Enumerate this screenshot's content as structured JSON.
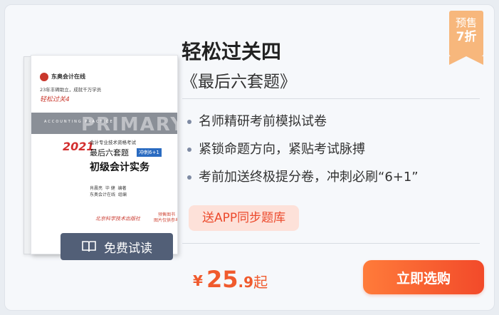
{
  "badge": {
    "line1": "预售",
    "line2": "7折"
  },
  "book_cover": {
    "brand": "东奥会计在线",
    "slogan": "23年丰碑助立，成就千万学员",
    "signature": "轻松过关4",
    "band_small": "ACCOUNTING PRACTICE",
    "band_big": "PRIMARY",
    "year": "2021",
    "series": "会计专业技术资格考试",
    "title1": "最后六套题",
    "chip": "冲刺6+1",
    "title2": "初级会计实务",
    "authors": "肖晨亮  毕 健  编著\n东奥会计在线  组编",
    "publisher": "北京科学技术出版社",
    "seal": "预售图书\n图片仅供参考"
  },
  "trial": {
    "label": "免费试读",
    "icon": "book-open-icon"
  },
  "product": {
    "title": "轻松过关四",
    "subtitle": "《最后六套题》",
    "features": [
      "名师精研考前模拟试卷",
      "紧锁命题方向，紧贴考试脉搏",
      "考前加送终极提分卷，冲刺必刷“6+1”"
    ],
    "promo": "送APP同步题库"
  },
  "price": {
    "currency": "¥",
    "integer": "25",
    "decimal": ".9",
    "suffix": "起"
  },
  "buy_button": {
    "label": "立即选购"
  },
  "colors": {
    "accent": "#f05a2d",
    "trial_bg": "#525f77",
    "presale_bg": "#f7b77c"
  }
}
